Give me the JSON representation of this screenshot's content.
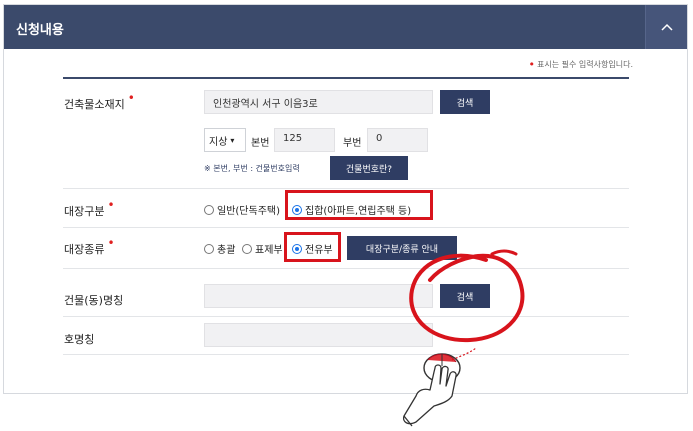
{
  "panel": {
    "title": "신청내용",
    "collapse_icon": "chevron-up-icon"
  },
  "required_note": "표시는 필수 입력사항입니다.",
  "address": {
    "label": "건축물소재지",
    "value": "인천광역시 서구 이음3로",
    "search_button": "검색",
    "land_type": "지상",
    "main_no_label": "본번",
    "main_no_value": "125",
    "sub_no_label": "부번",
    "sub_no_value": "0",
    "hint": "※ 본번, 부번 : 건물번호입력",
    "building_no_button": "건물번호란?"
  },
  "ledger_category": {
    "label": "대장구분",
    "options": [
      {
        "label": "일반(단독주택)",
        "selected": false
      },
      {
        "label": "집합(아파트,연립주택 등)",
        "selected": true
      }
    ]
  },
  "ledger_type": {
    "label": "대장종류",
    "options": [
      {
        "label": "총괄",
        "selected": false
      },
      {
        "label": "표제부",
        "selected": false
      },
      {
        "label": "전유부",
        "selected": true
      }
    ],
    "guide_button": "대장구분/종류 안내"
  },
  "building_name": {
    "label": "건물(동)명칭",
    "value": "",
    "search_button": "검색"
  },
  "unit_name": {
    "label": "호명칭",
    "value": ""
  },
  "colors": {
    "header": "#3b4a6b",
    "button": "#2f3d63",
    "highlight": "#d8141c",
    "required": "#e02020"
  }
}
